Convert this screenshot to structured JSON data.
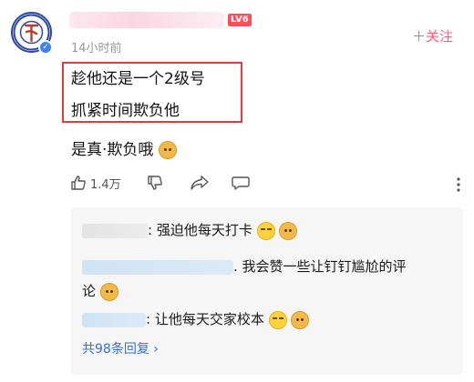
{
  "comment": {
    "level_badge": "LV6",
    "time": "14小时前",
    "follow": "＋关注",
    "lines": [
      "趁他还是一个2级号",
      "抓紧时间欺负他"
    ],
    "body": "是真·欺负哦",
    "like_count": "1.4万"
  },
  "replies": {
    "items": [
      {
        "text": ": 强迫他每天打卡"
      },
      {
        "text": ". 我会赞一些让钉钉尴尬的评",
        "text2": "论"
      },
      {
        "text": ": 让他每天交家校本"
      }
    ],
    "more_label": "共98条回复 ›"
  },
  "colors": {
    "accent": "#ff5a7a",
    "link": "#3a72c4",
    "highlight_border": "#e03c3c",
    "level_badge": "#ff4f58"
  }
}
